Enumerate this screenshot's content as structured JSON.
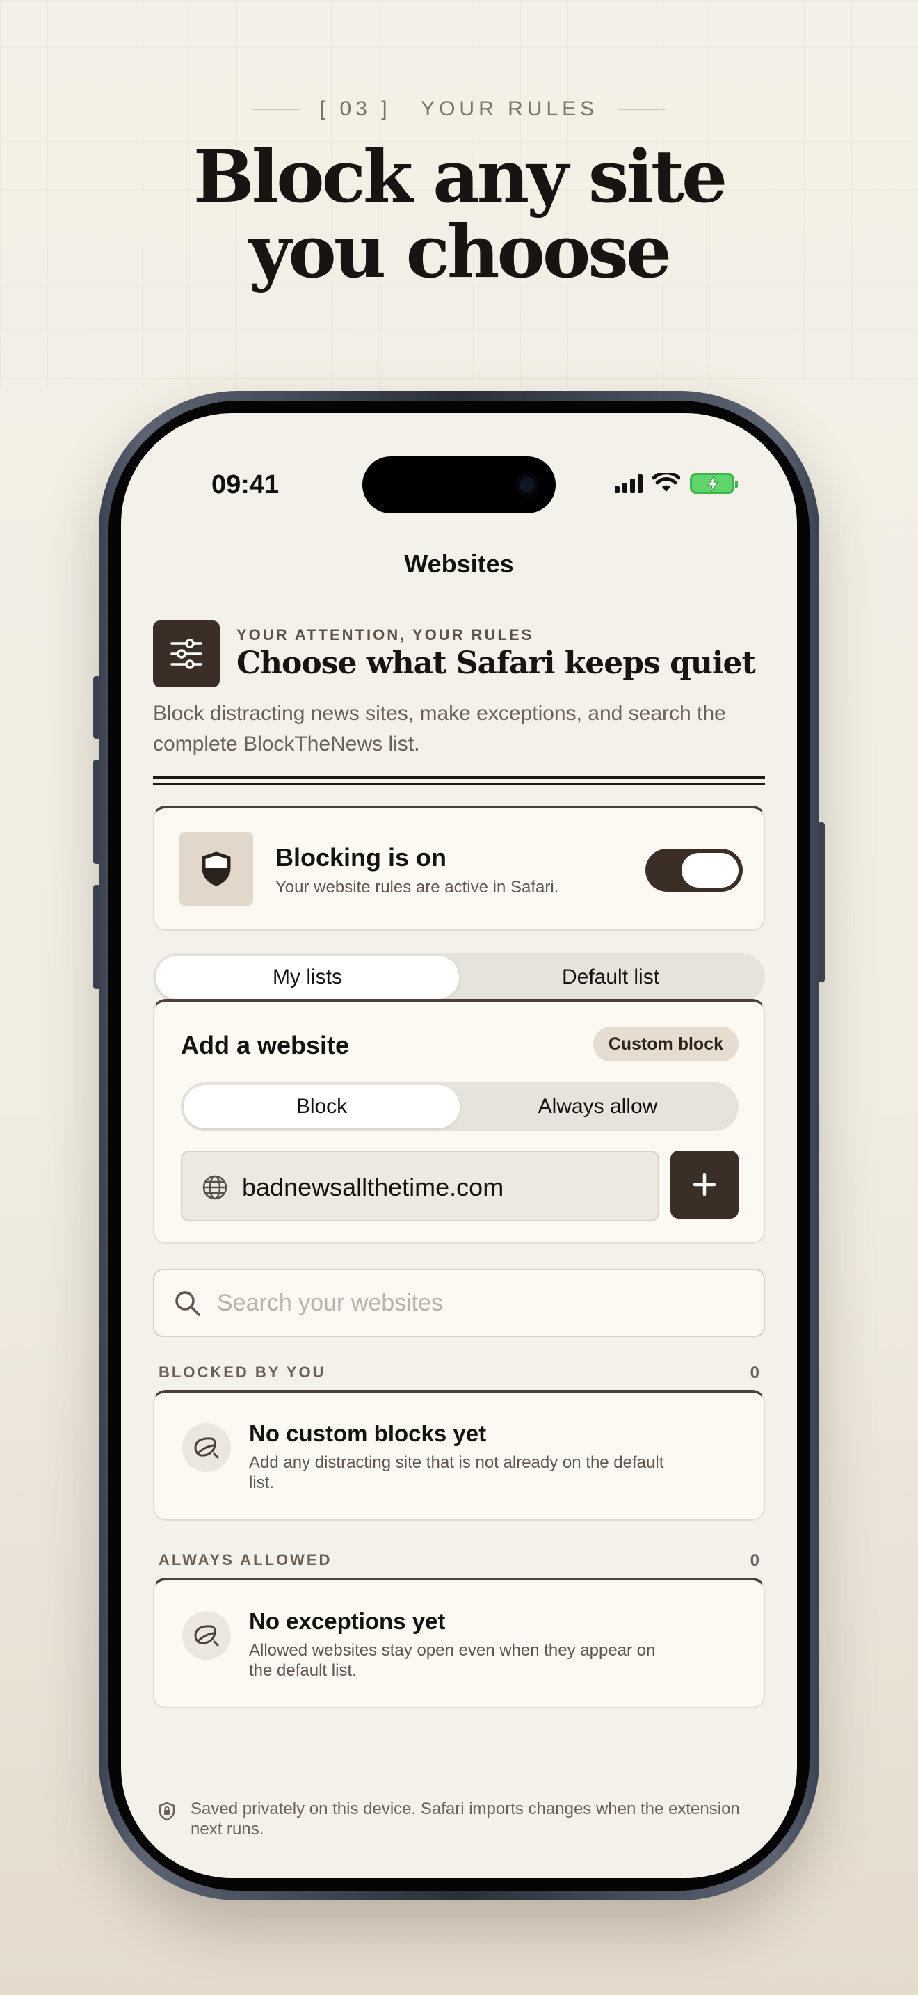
{
  "marketing": {
    "eyebrow": "[ 03 ]   YOUR RULES",
    "headline_line1": "Block any site",
    "headline_line2": "you choose"
  },
  "status_bar": {
    "time": "09:41"
  },
  "nav": {
    "title": "Websites"
  },
  "header": {
    "kicker": "YOUR ATTENTION, YOUR RULES",
    "title": "Choose what Safari keeps quiet",
    "description": "Block distracting news sites, make exceptions, and search the complete BlockTheNews list."
  },
  "blocking": {
    "title": "Blocking is on",
    "subtitle": "Your website rules are active in Safari.",
    "enabled": true
  },
  "list_tabs": {
    "options": [
      "My lists",
      "Default list"
    ],
    "selected": "My lists"
  },
  "add_website": {
    "title": "Add a website",
    "chip": "Custom block",
    "mode_options": [
      "Block",
      "Always allow"
    ],
    "mode_selected": "Block",
    "url_value": "badnewsallthetime.com"
  },
  "search": {
    "placeholder": "Search your websites"
  },
  "blocked_section": {
    "label": "BLOCKED BY YOU",
    "count": "0",
    "empty_title": "No custom blocks yet",
    "empty_subtitle": "Add any distracting site that is not already on the default list."
  },
  "allowed_section": {
    "label": "ALWAYS ALLOWED",
    "count": "0",
    "empty_title": "No exceptions yet",
    "empty_subtitle": "Allowed websites stay open even when they appear on the default list."
  },
  "footer": {
    "note": "Saved privately on this device. Safari imports changes when the extension next runs."
  },
  "colors": {
    "accent_dark": "#3a2e27",
    "background": "#f3f1ea",
    "card": "#fbf9f2",
    "battery_green": "#5ed46a"
  }
}
